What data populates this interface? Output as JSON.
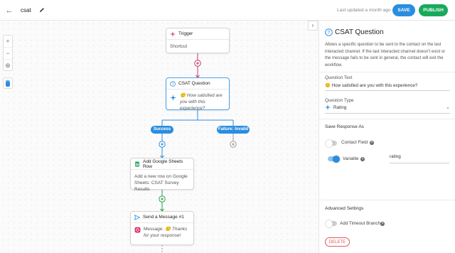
{
  "header": {
    "workflow_name": "csat",
    "last_updated": "Last updated a month ago",
    "save_label": "SAVE",
    "publish_label": "PUBLISH",
    "back_icon": "arrow-left-icon",
    "edit_icon": "pencil-icon"
  },
  "canvas": {
    "nodes": {
      "trigger": {
        "title": "Trigger",
        "body": "Shortcut"
      },
      "csat": {
        "title": "CSAT Question",
        "body": "🙂 How satisfied are you with this experience?"
      },
      "sheets": {
        "title": "Add Google Sheets Row",
        "body": "Add a new row on Google Sheets: CSAT Survey Results"
      },
      "message": {
        "title": "Send a Message #1",
        "body_label": "Message:",
        "body_text": "🙂 Thanks for your response!"
      }
    },
    "branches": {
      "success": "Success",
      "failure": "Failure: Invalid"
    },
    "colors": {
      "trigger_edge": "#c43a6a",
      "csat_edge": "#2a8de0",
      "success_edge": "#2a9d4e",
      "failure_edge": "#999999"
    }
  },
  "panel": {
    "title": "CSAT Question",
    "description": "Allows a specific question to be sent to the contact on the last interacted channel. If the last interacted channel doesn't exist or the message fails to be sent in general, the contact will exit the workflow.",
    "question_text_label": "Question Text",
    "question_text_value": "🙂 How satisfied are you with this experience?",
    "question_type_label": "Question Type",
    "question_type_value": "Rating",
    "save_response_as_label": "Save Response As",
    "contact_field_label": "Contact Field",
    "variable_label": "Variable",
    "variable_value": "rating",
    "advanced_settings_label": "Advanced Settings",
    "add_timeout_branch_label": "Add Timeout Branch",
    "delete_label": "DELETE",
    "contact_field_enabled": false,
    "variable_enabled": true,
    "timeout_enabled": false
  }
}
